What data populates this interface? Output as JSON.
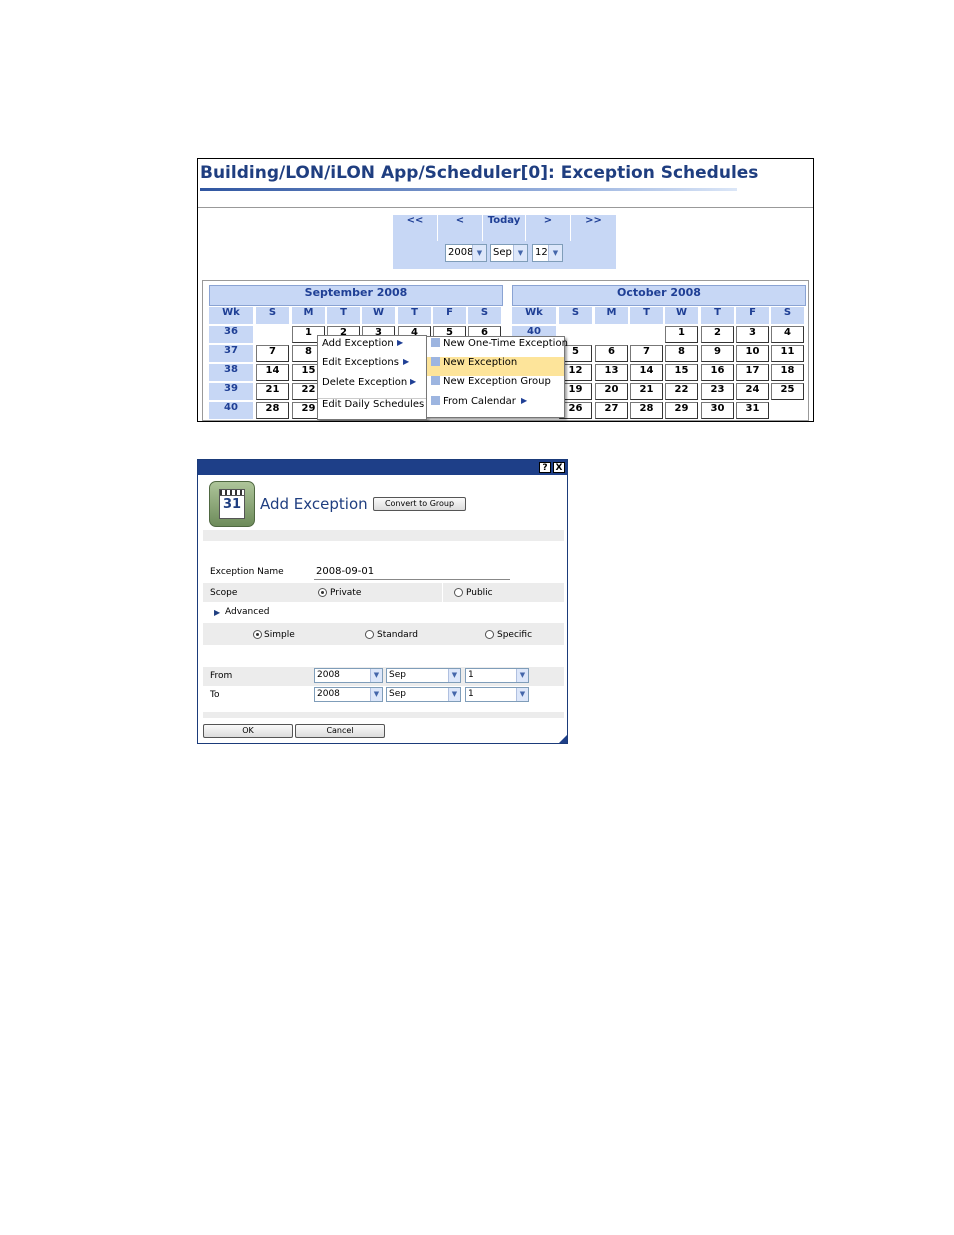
{
  "scheduler": {
    "title": "Building/LON/iLON App/Scheduler[0]: Exception Schedules",
    "nav": {
      "first": "<<",
      "prev": "<",
      "today": "Today",
      "next": ">",
      "last": ">>",
      "year": "2008",
      "month": "Sep",
      "day": "12"
    },
    "calendars": [
      {
        "title": "September 2008",
        "headers": [
          "Wk",
          "S",
          "M",
          "T",
          "W",
          "T",
          "F",
          "S"
        ],
        "weeks": [
          {
            "wk": "36",
            "days": [
              "",
              "1",
              "2",
              "3",
              "4",
              "5",
              "6"
            ]
          },
          {
            "wk": "37",
            "days": [
              "7",
              "8",
              "",
              "",
              "",
              "",
              ""
            ]
          },
          {
            "wk": "38",
            "days": [
              "14",
              "15",
              "",
              "",
              "",
              "",
              ""
            ]
          },
          {
            "wk": "39",
            "days": [
              "21",
              "22",
              "",
              "",
              "",
              "",
              ""
            ]
          },
          {
            "wk": "40",
            "days": [
              "28",
              "29",
              "",
              "",
              "",
              "",
              ""
            ]
          }
        ]
      },
      {
        "title": "October 2008",
        "headers": [
          "Wk",
          "S",
          "M",
          "T",
          "W",
          "T",
          "F",
          "S"
        ],
        "weeks": [
          {
            "wk": "40",
            "days": [
              "",
              "",
              "",
              "1",
              "2",
              "3",
              "4"
            ]
          },
          {
            "wk": "",
            "days": [
              "5",
              "6",
              "7",
              "8",
              "9",
              "10",
              "11"
            ]
          },
          {
            "wk": "",
            "days": [
              "12",
              "13",
              "14",
              "15",
              "16",
              "17",
              "18"
            ]
          },
          {
            "wk": "",
            "days": [
              "19",
              "20",
              "21",
              "22",
              "23",
              "24",
              "25"
            ]
          },
          {
            "wk": "",
            "days": [
              "26",
              "27",
              "28",
              "29",
              "30",
              "31",
              ""
            ]
          }
        ]
      }
    ],
    "context_menu": [
      "Add Exception",
      "Edit Exceptions",
      "Delete Exception",
      "Edit Daily Schedules"
    ],
    "submenu": [
      "New One-Time Exception",
      "New Exception",
      "New Exception Group",
      "From Calendar"
    ],
    "highlight_color": "#fde49a",
    "accent_color": "#c7d7f5"
  },
  "dialog": {
    "help": "?",
    "close": "X",
    "icon_day": "31",
    "title": "Add Exception",
    "convert_button": "Convert to Group",
    "exception_name_label": "Exception Name",
    "exception_name_value": "2008-09-01",
    "scope_label": "Scope",
    "scope_private": "Private",
    "scope_public": "Public",
    "advanced": "Advanced",
    "mode_simple": "Simple",
    "mode_standard": "Standard",
    "mode_specific": "Specific",
    "from_label": "From",
    "to_label": "To",
    "from": {
      "year": "2008",
      "month": "Sep",
      "day": "1"
    },
    "to": {
      "year": "2008",
      "month": "Sep",
      "day": "1"
    },
    "ok": "OK",
    "cancel": "Cancel"
  }
}
